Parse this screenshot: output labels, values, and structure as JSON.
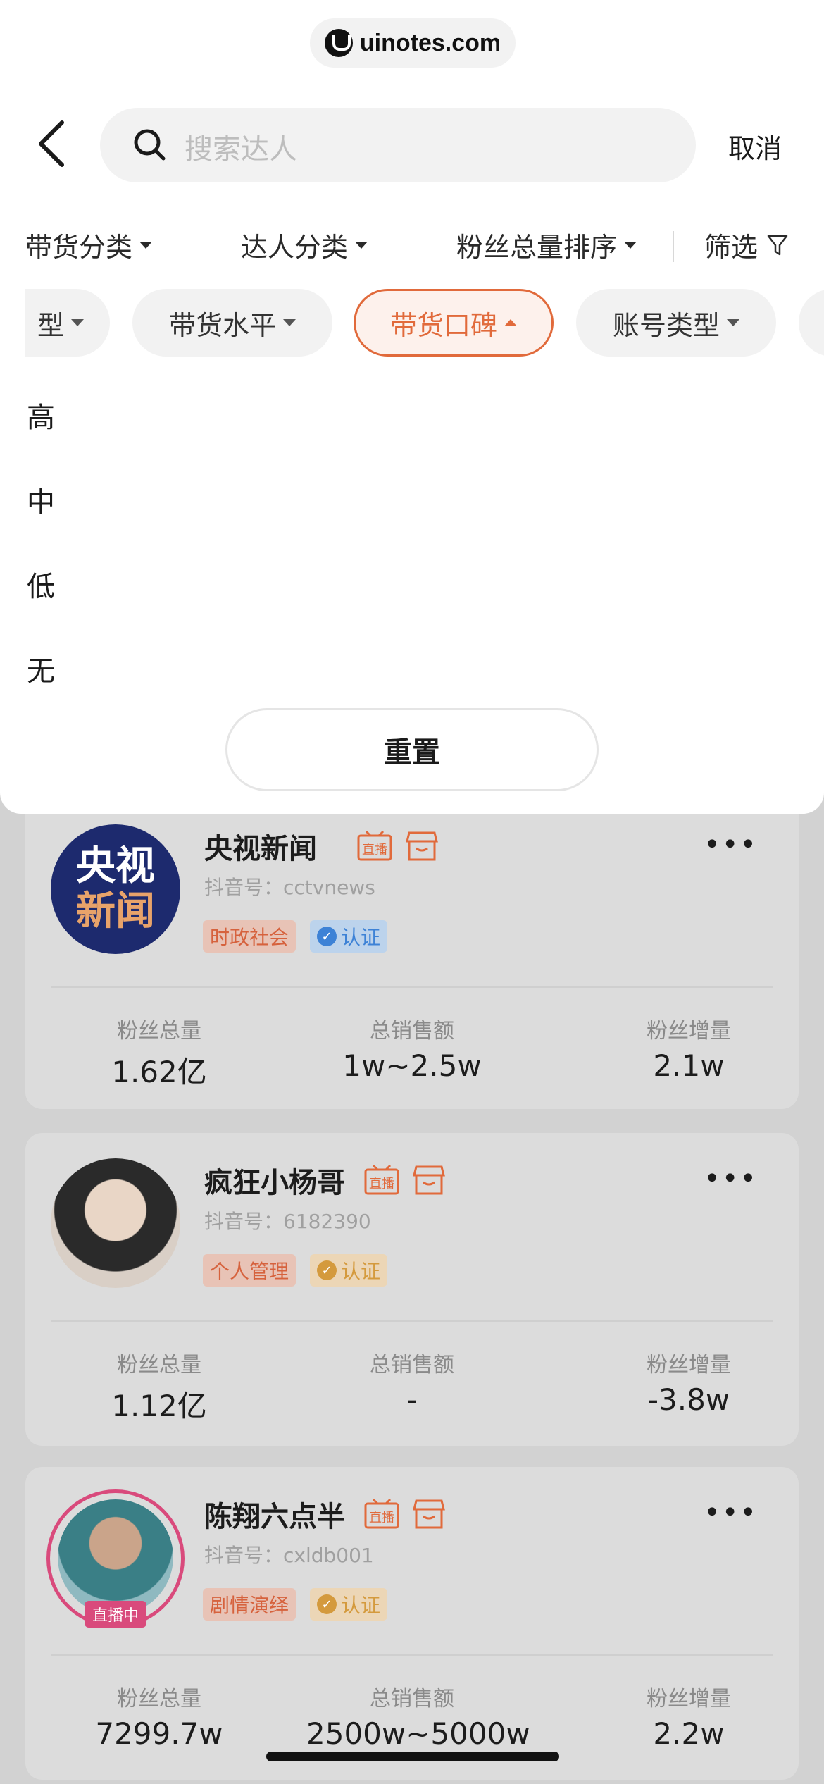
{
  "watermark": {
    "text": "uinotes.com"
  },
  "header": {
    "search_placeholder": "搜索达人",
    "cancel_label": "取消"
  },
  "sort_bar": {
    "items": [
      {
        "label": "带货分类"
      },
      {
        "label": "达人分类"
      },
      {
        "label": "粉丝总量排序"
      }
    ],
    "filter_label": "筛选"
  },
  "filter_chips": [
    {
      "label": "型"
    },
    {
      "label": "带货水平"
    },
    {
      "label": "带货口碑",
      "active": true
    },
    {
      "label": "账号类型"
    }
  ],
  "dropdown": {
    "options": [
      {
        "label": "高"
      },
      {
        "label": "中"
      },
      {
        "label": "低"
      },
      {
        "label": "无"
      }
    ],
    "reset_label": "重置"
  },
  "results": [
    {
      "name": "央视新闻",
      "avatar_text": [
        "央视",
        "新闻"
      ],
      "douyin_id": "抖音号：cctvnews",
      "category": "时政社会",
      "auth": "认证",
      "auth_color": "blue",
      "stats": [
        {
          "label": "粉丝总量",
          "value": "1.62亿"
        },
        {
          "label": "总销售额",
          "value": "1w~2.5w"
        },
        {
          "label": "粉丝增量",
          "value": "2.1w"
        }
      ]
    },
    {
      "name": "疯狂小杨哥",
      "douyin_id": "抖音号：6182390",
      "category": "个人管理",
      "auth": "认证",
      "auth_color": "yellow",
      "stats": [
        {
          "label": "粉丝总量",
          "value": "1.12亿"
        },
        {
          "label": "总销售额",
          "value": "-"
        },
        {
          "label": "粉丝增量",
          "value": "-3.8w"
        }
      ]
    },
    {
      "name": "陈翔六点半",
      "douyin_id": "抖音号：cxldb001",
      "category": "剧情演绎",
      "auth": "认证",
      "auth_color": "yellow",
      "live_badge": "直播中",
      "stats": [
        {
          "label": "粉丝总量",
          "value": "7299.7w"
        },
        {
          "label": "总销售额",
          "value": "2500w~5000w"
        },
        {
          "label": "粉丝增量",
          "value": "2.2w"
        }
      ]
    }
  ],
  "live_icon_label": "直播",
  "colors": {
    "accent": "#e16a3b",
    "live_pink": "#d94a7c",
    "auth_blue": "#3d82d6",
    "auth_yellow": "#d49a3d"
  }
}
